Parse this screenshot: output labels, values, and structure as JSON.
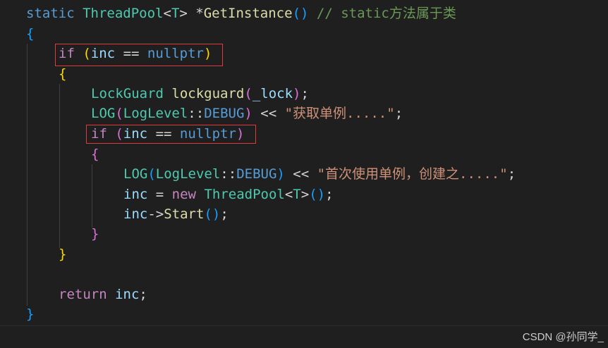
{
  "code": {
    "l1": {
      "kw_static": "static",
      "type_class": "ThreadPool",
      "lt": "<",
      "tparam": "T",
      "gt": ">",
      "star": " *",
      "fn_name": "GetInstance",
      "parens": "()",
      "comment": "// static方法属于类"
    },
    "l2": {
      "brace": "{"
    },
    "l3": {
      "kw_if": "if",
      "open": "(",
      "var": "inc",
      "op": " == ",
      "null": "nullptr",
      "close": ")"
    },
    "l4": {
      "brace": "{"
    },
    "l5": {
      "type": "LockGuard",
      "name": "lockguard",
      "open": "(",
      "arg": "_lock",
      "close": ")",
      "semi": ";"
    },
    "l6": {
      "macro": "LOG",
      "open": "(",
      "enum": "LogLevel",
      "scope": "::",
      "member": "DEBUG",
      "close": ")",
      "op": " << ",
      "str": "\"获取单例.....\"",
      "semi": ";"
    },
    "l7": {
      "kw_if": "if",
      "open": "(",
      "var": "inc",
      "op": " == ",
      "null": "nullptr",
      "close": ")"
    },
    "l8": {
      "brace": "{"
    },
    "l9": {
      "macro": "LOG",
      "open": "(",
      "enum": "LogLevel",
      "scope": "::",
      "member": "DEBUG",
      "close": ")",
      "op": " << ",
      "str": "\"首次使用单例，创建之.....\"",
      "semi": ";"
    },
    "l10": {
      "var": "inc",
      "op": " = ",
      "kw_new": "new",
      "type": "ThreadPool",
      "lt": "<",
      "tparam": "T",
      "gt": ">",
      "parens": "()",
      "semi": ";"
    },
    "l11": {
      "var": "inc",
      "arrow": "->",
      "fn": "Start",
      "parens": "()",
      "semi": ";"
    },
    "l12": {
      "brace": "}"
    },
    "l13": {
      "brace": "}"
    },
    "l15": {
      "kw_return": "return",
      "var": "inc",
      "semi": ";"
    },
    "l16": {
      "brace": "}"
    }
  },
  "watermark": "CSDN @孙同学_",
  "colors": {
    "background": "#1f1f1f",
    "keyword": "#569cd6",
    "control": "#c586c0",
    "type": "#4ec9b0",
    "function": "#dcdcaa",
    "variable": "#9cdcfe",
    "string": "#ce9178",
    "comment": "#6a9955",
    "highlight_box": "#e0393e"
  }
}
